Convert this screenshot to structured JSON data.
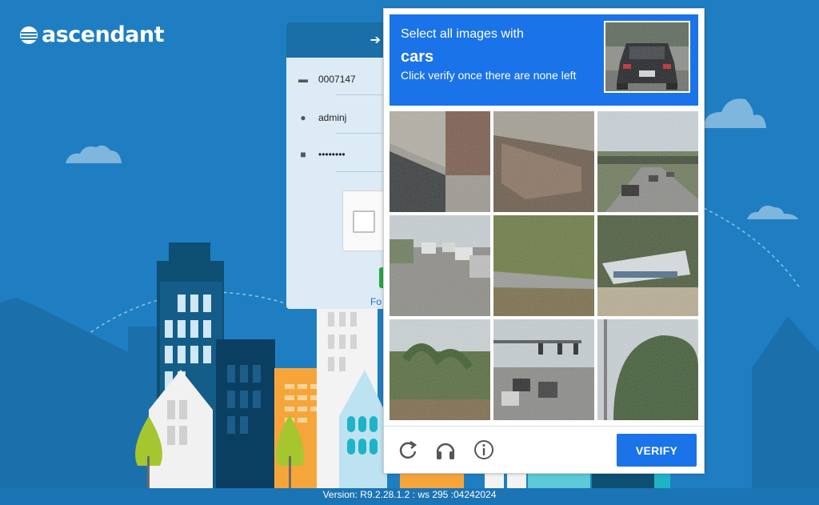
{
  "brand": {
    "name": "ascendant"
  },
  "login": {
    "account_number": "0007147",
    "username": "adminj",
    "password_masked": "••••••••",
    "forgot_fragment": "Fo",
    "icons": {
      "card": "credit-card-icon",
      "user": "user-icon",
      "lock": "lock-icon",
      "signin": "sign-in-icon"
    }
  },
  "challenge": {
    "line1": "Select all images with",
    "keyword": "cars",
    "line2": "Click verify once there are none left",
    "verify_label": "VERIFY",
    "tools": [
      "reload-icon",
      "audio-headphones-icon",
      "info-icon"
    ],
    "tiles": [
      "sidewalk-shadow",
      "concrete-barrier",
      "highway-traffic",
      "street-cars",
      "grass-guardrail",
      "boat-trailer",
      "palm-shrubs",
      "intersection-traffic-lights",
      "trees-pole"
    ]
  },
  "footer": {
    "version": "Version: R9.2.28.1.2 : ws 295 :04242024"
  },
  "colors": {
    "background": "#1f7ec2",
    "challenge_blue": "#1a73e8",
    "header_blue": "#1a6fa7"
  }
}
